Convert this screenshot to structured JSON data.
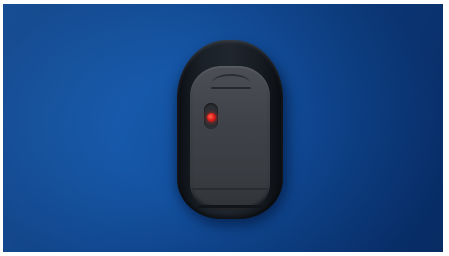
{
  "scene": {
    "subject": "wireless-mouse-underside",
    "colors": {
      "background_blue": "#1657a8",
      "mouse_shell": "#1b2129",
      "mouse_base": "#3f4349",
      "sensor_led": "#e0201c"
    },
    "icons": {
      "sensor": "led-sensor-icon"
    }
  }
}
